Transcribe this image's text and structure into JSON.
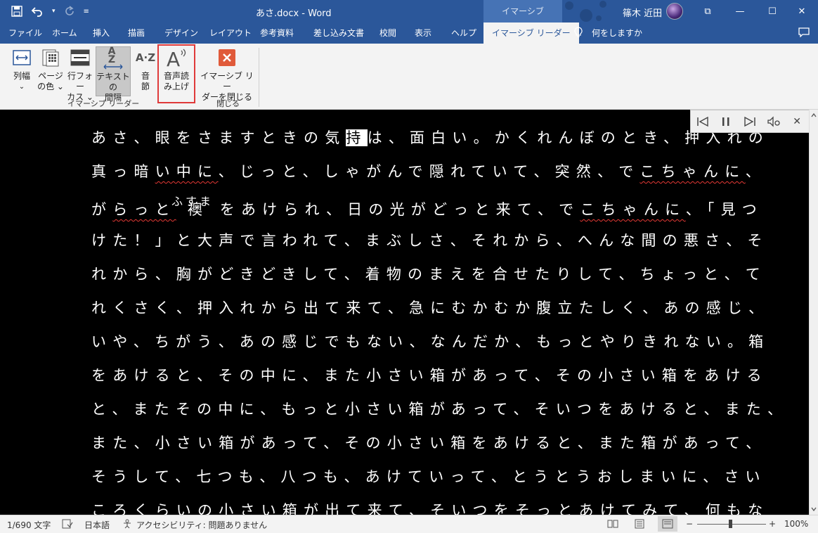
{
  "titlebar": {
    "doc_title": "あさ.docx  -  Word",
    "context_tab": "イマーシブ",
    "user": "篠木 近田",
    "restore_glyph": "⧉",
    "minimize_glyph": "—",
    "maximize_glyph": "☐",
    "close_glyph": "✕"
  },
  "tabs": [
    {
      "label": "ファイル"
    },
    {
      "label": "ホーム"
    },
    {
      "label": "挿入"
    },
    {
      "label": "描画"
    },
    {
      "label": "デザイン"
    },
    {
      "label": "レイアウト"
    },
    {
      "label": "参考資料"
    },
    {
      "label": "差し込み文書"
    },
    {
      "label": "校閲"
    },
    {
      "label": "表示"
    },
    {
      "label": "ヘルプ"
    },
    {
      "label": "イマーシブ リーダー",
      "active": true
    },
    {
      "label": "何をしますか"
    }
  ],
  "ribbon": {
    "column_width": {
      "line1": "列幅",
      "line2": "⌄"
    },
    "page_color": {
      "line1": "ページ",
      "line2": "の色 ⌄"
    },
    "line_focus": {
      "line1": "行フォー",
      "line2": "カス ⌄"
    },
    "text_spacing": {
      "line1": "テキストの",
      "line2": "間隔",
      "selected": true
    },
    "syllables": {
      "line1": "音",
      "line2": "節"
    },
    "read_aloud": {
      "line1": "音声読",
      "line2": "み上げ",
      "highlighted": true
    },
    "close_reader": {
      "line1": "イマーシブ リー",
      "line2": "ダーを閉じる"
    },
    "group_immersive": "イマーシブ リーダー",
    "group_close": "閉じる",
    "syllables_icon_text": "A·Z",
    "text_spacing_icon_text": "A Z"
  },
  "document": {
    "lines": [
      {
        "pre": "あさ、眼をさますときの気",
        "hl": "持",
        "post": "は、面白い。かくれんぼのとき、押入れの"
      },
      {
        "pre": "真っ暗",
        "wavy": "い中に",
        "post": "、じっと、しゃがんで隠れていて、突然、で",
        "wavy2": "こちゃんに",
        "post2": "、"
      },
      {
        "pre": "が",
        "wavy": "らっと",
        "post": " 襖 をあけられ、日の光がどっと来て、で",
        "wavy2": "こちゃんに",
        "post2": "、「見つ"
      },
      {
        "pre": "けた！」と大声で言われて、まぶしさ、それから、へんな間の悪さ、そ"
      },
      {
        "pre": "れから、胸がどきどきして、着物のまえを合せたりして、ちょっと、て"
      },
      {
        "pre": "れくさく、押入れから出て来て、急にむかむか腹立たしく、あの感じ、"
      },
      {
        "pre": "いや、ちがう、あの感じでもない、なんだか、もっとやりきれない。箱"
      },
      {
        "pre": "をあけると、その中に、また小さい箱があって、その小さい箱をあける"
      },
      {
        "pre": "と、またその中に、もっと小さい箱があって、そいつをあけると、また、"
      },
      {
        "pre": "また、小さい箱があって、その小さい箱をあけると、また箱があって、"
      },
      {
        "pre": "そうして、七つも、八つも、あけていって、とうとうおしまいに、さい"
      },
      {
        "pre": "ころくらいの小さい箱が出て来て、そいつをそっとあけてみて、何もな"
      }
    ],
    "ruby": "ふすま"
  },
  "player": {
    "prev": "⏮",
    "pause": "❚❚",
    "next": "⏭",
    "settings": "⚙",
    "close": "✕"
  },
  "status": {
    "pages": "1/690 文字",
    "language": "日本語",
    "accessibility": "アクセシビリティ: 問題ありません",
    "zoom": "100%"
  }
}
